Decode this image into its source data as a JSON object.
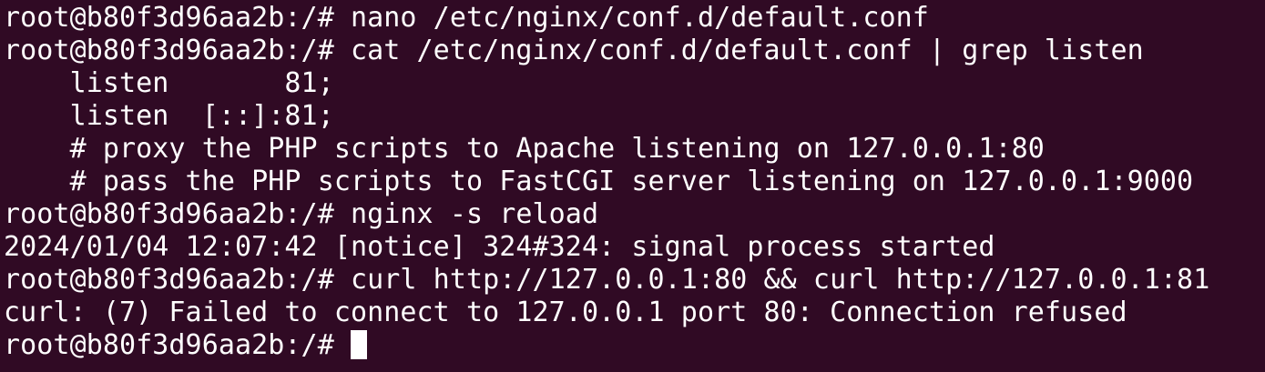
{
  "terminal": {
    "lines": [
      "root@b80f3d96aa2b:/# nano /etc/nginx/conf.d/default.conf",
      "root@b80f3d96aa2b:/# cat /etc/nginx/conf.d/default.conf | grep listen",
      "    listen       81;",
      "    listen  [::]:81;",
      "    # proxy the PHP scripts to Apache listening on 127.0.0.1:80",
      "    # pass the PHP scripts to FastCGI server listening on 127.0.0.1:9000",
      "root@b80f3d96aa2b:/# nginx -s reload",
      "2024/01/04 12:07:42 [notice] 324#324: signal process started",
      "root@b80f3d96aa2b:/# curl http://127.0.0.1:80 && curl http://127.0.0.1:81",
      "curl: (7) Failed to connect to 127.0.0.1 port 80: Connection refused"
    ],
    "prompt": "root@b80f3d96aa2b:/# "
  }
}
